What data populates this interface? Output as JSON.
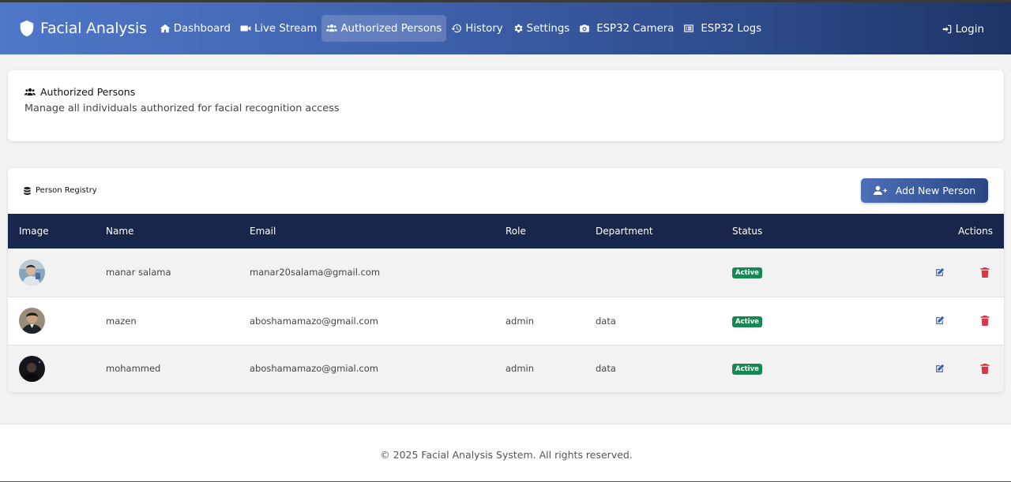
{
  "app": {
    "brand": "Facial Analysis",
    "brand_icon": "shield-icon"
  },
  "nav": {
    "items": [
      {
        "label": "Dashboard",
        "icon": "home-icon"
      },
      {
        "label": "Live Stream",
        "icon": "video-icon"
      },
      {
        "label": "Authorized Persons",
        "icon": "users-icon",
        "active": true
      },
      {
        "label": "History",
        "icon": "history-icon"
      },
      {
        "label": "Settings",
        "icon": "gear-icon"
      },
      {
        "label": "ESP32 Camera",
        "icon": "camera-icon"
      },
      {
        "label": "ESP32 Logs",
        "icon": "list-icon"
      }
    ],
    "login": "Login"
  },
  "header": {
    "title": "Authorized Persons",
    "subtitle": "Manage all individuals authorized for facial recognition access"
  },
  "registry": {
    "title": "Person Registry",
    "add_button": "Add New Person",
    "columns": [
      "Image",
      "Name",
      "Email",
      "Role",
      "Department",
      "Status",
      "Actions"
    ],
    "rows": [
      {
        "name": "manar salama",
        "email": "manar20salama@gmail.com",
        "role": "",
        "department": "",
        "status": "Active"
      },
      {
        "name": "mazen",
        "email": "aboshamamazo@gmail.com",
        "role": "admin",
        "department": "data",
        "status": "Active"
      },
      {
        "name": "mohammed",
        "email": "aboshamamazo@gmial.com",
        "role": "admin",
        "department": "data",
        "status": "Active"
      }
    ]
  },
  "footer": {
    "text": "© 2025 Facial Analysis System. All rights reserved."
  },
  "colors": {
    "nav_start": "#5077c8",
    "nav_end": "#1e3466",
    "table_header": "#17264a",
    "status_active": "#198754",
    "edit": "#2c5fa8",
    "delete": "#dc3545"
  }
}
